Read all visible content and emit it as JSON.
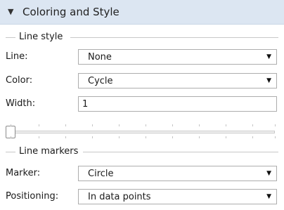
{
  "section": {
    "title": "Coloring and Style",
    "icon": "triangle-down-icon"
  },
  "line_style": {
    "title": "Line style",
    "line": {
      "label": "Line:",
      "value": "None"
    },
    "color": {
      "label": "Color:",
      "value": "Cycle"
    },
    "width": {
      "label": "Width:",
      "value": "1"
    }
  },
  "line_markers": {
    "title": "Line markers",
    "marker": {
      "label": "Marker:",
      "value": "Circle"
    },
    "positioning": {
      "label": "Positioning:",
      "value": "In data points"
    }
  },
  "slider": {
    "value": 0
  }
}
